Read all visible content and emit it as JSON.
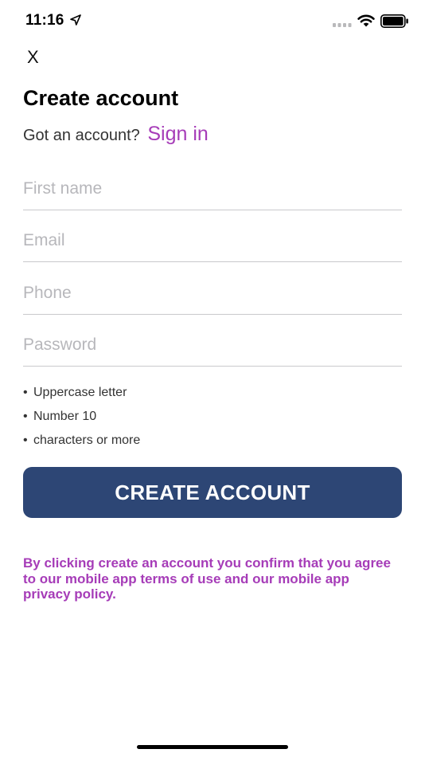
{
  "status_bar": {
    "time": "11:16"
  },
  "close_label": "X",
  "title": "Create account",
  "signin": {
    "prompt": "Got an account?",
    "link": "Sign in"
  },
  "fields": {
    "first_name_placeholder": "First name",
    "email_placeholder": "Email",
    "phone_placeholder": "Phone",
    "password_placeholder": "Password"
  },
  "password_rules": [
    "Uppercase letter",
    "Number 10",
    "characters or more"
  ],
  "create_button_label": "CREATE ACCOUNT",
  "terms_text": "By clicking create an account you confirm that you agree to our mobile app terms of use and our mobile app privacy policy.",
  "colors": {
    "accent": "#a63cb8",
    "button": "#2d4675"
  }
}
